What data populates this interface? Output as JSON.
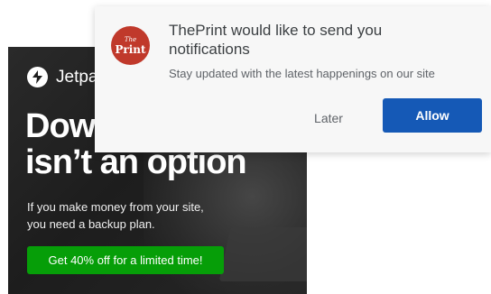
{
  "ad": {
    "brand_name": "Jetpack",
    "logo_icon": "lightning-bolt-icon",
    "headline_line1": "Downtime",
    "headline_line2": "isn’t an option",
    "body_line1": "If you make money from your site,",
    "body_line2": "you need a backup plan.",
    "cta_label": "Get 40% off for a limited time!",
    "cta_color": "#069e08"
  },
  "notification": {
    "site_logo_small": "The",
    "site_logo_big": "Print",
    "site_logo_color": "#c0392b",
    "title": "ThePrint would like to send you notifications",
    "subtitle": "Stay updated with the latest happenings on our site",
    "later_label": "Later",
    "allow_label": "Allow",
    "allow_color": "#1559b6"
  }
}
